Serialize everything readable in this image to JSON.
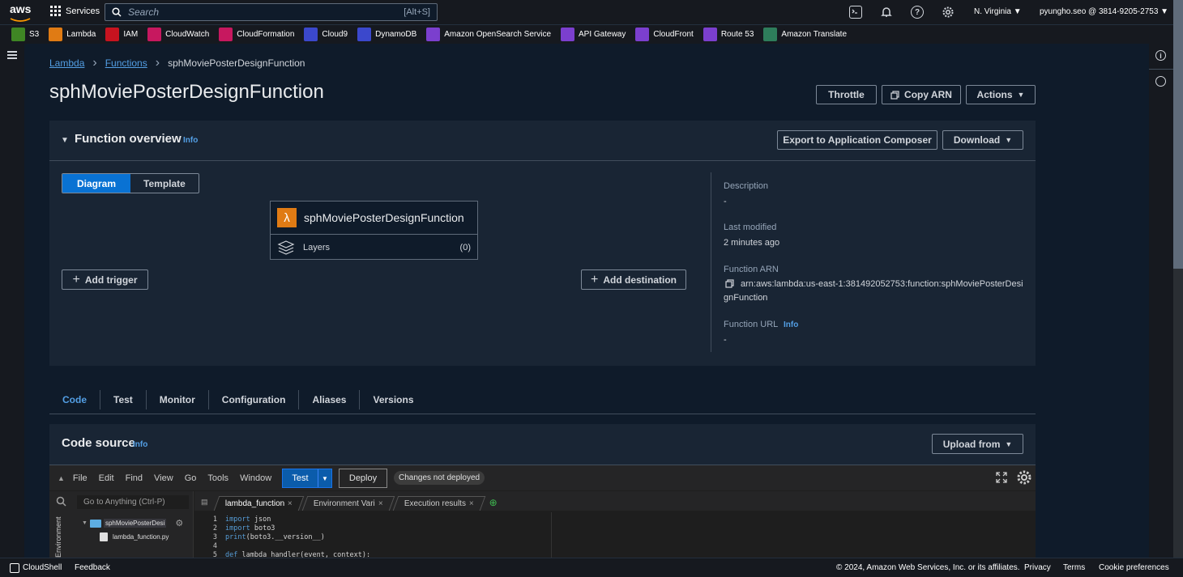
{
  "topbar": {
    "logo_text": "aws",
    "services_label": "Services",
    "search_placeholder": "Search",
    "search_shortcut": "[Alt+S]",
    "region": "N. Virginia",
    "account": "pyungho.seo @ 3814-9205-2753"
  },
  "favorites": [
    {
      "label": "S3",
      "color": "#3f8624"
    },
    {
      "label": "Lambda",
      "color": "#e07b14"
    },
    {
      "label": "IAM",
      "color": "#c7131f"
    },
    {
      "label": "CloudWatch",
      "color": "#c7185f"
    },
    {
      "label": "CloudFormation",
      "color": "#c7185f"
    },
    {
      "label": "Cloud9",
      "color": "#3b48cc"
    },
    {
      "label": "DynamoDB",
      "color": "#3b48cc"
    },
    {
      "label": "Amazon OpenSearch Service",
      "color": "#7b3fce"
    },
    {
      "label": "API Gateway",
      "color": "#7b3fce"
    },
    {
      "label": "CloudFront",
      "color": "#7b3fce"
    },
    {
      "label": "Route 53",
      "color": "#7b3fce"
    },
    {
      "label": "Amazon Translate",
      "color": "#2e7d5b"
    }
  ],
  "breadcrumb": {
    "lambda": "Lambda",
    "functions": "Functions",
    "current": "sphMoviePosterDesignFunction"
  },
  "page": {
    "title": "sphMoviePosterDesignFunction",
    "throttle": "Throttle",
    "copy_arn": "Copy ARN",
    "actions": "Actions"
  },
  "overview": {
    "title": "Function overview",
    "info": "Info",
    "export": "Export to Application Composer",
    "download": "Download",
    "tab_diagram": "Diagram",
    "tab_template": "Template",
    "function_name": "sphMoviePosterDesignFunction",
    "layers_label": "Layers",
    "layers_count": "(0)",
    "add_trigger": "Add trigger",
    "add_destination": "Add destination",
    "description_label": "Description",
    "description_value": "-",
    "last_modified_label": "Last modified",
    "last_modified_value": "2 minutes ago",
    "arn_label": "Function ARN",
    "arn_line1": "arn:aws:lambda:us-east-1:381492052753:function:sphMoviePosterDesi",
    "arn_line2": "gnFunction",
    "url_label": "Function URL",
    "url_info": "Info",
    "url_value": "-"
  },
  "tabs": [
    "Code",
    "Test",
    "Monitor",
    "Configuration",
    "Aliases",
    "Versions"
  ],
  "code_source": {
    "title": "Code source",
    "info": "Info",
    "upload": "Upload from"
  },
  "ide": {
    "menu": [
      "File",
      "Edit",
      "Find",
      "View",
      "Go",
      "Tools",
      "Window"
    ],
    "test": "Test",
    "deploy": "Deploy",
    "status": "Changes not deployed",
    "goto": "Go to Anything (Ctrl-P)",
    "folder": "sphMoviePosterDesi",
    "file": "lambda_function.py",
    "env_label": "Environment",
    "tabs": [
      "lambda_function",
      "Environment Vari",
      "Execution results"
    ],
    "lines": [
      {
        "n": "1",
        "kw": "import",
        "rest": " json"
      },
      {
        "n": "2",
        "kw": "import",
        "rest": " boto3"
      },
      {
        "n": "3",
        "kw": "print",
        "rest": "(boto3.__version__)"
      },
      {
        "n": "4",
        "kw": "",
        "rest": ""
      },
      {
        "n": "5",
        "kw": "def",
        "rest": " lambda_handler(event, context):"
      }
    ]
  },
  "footer": {
    "cloudshell": "CloudShell",
    "feedback": "Feedback",
    "copyright": "© 2024, Amazon Web Services, Inc. or its affiliates.",
    "privacy": "Privacy",
    "terms": "Terms",
    "cookies": "Cookie preferences"
  }
}
